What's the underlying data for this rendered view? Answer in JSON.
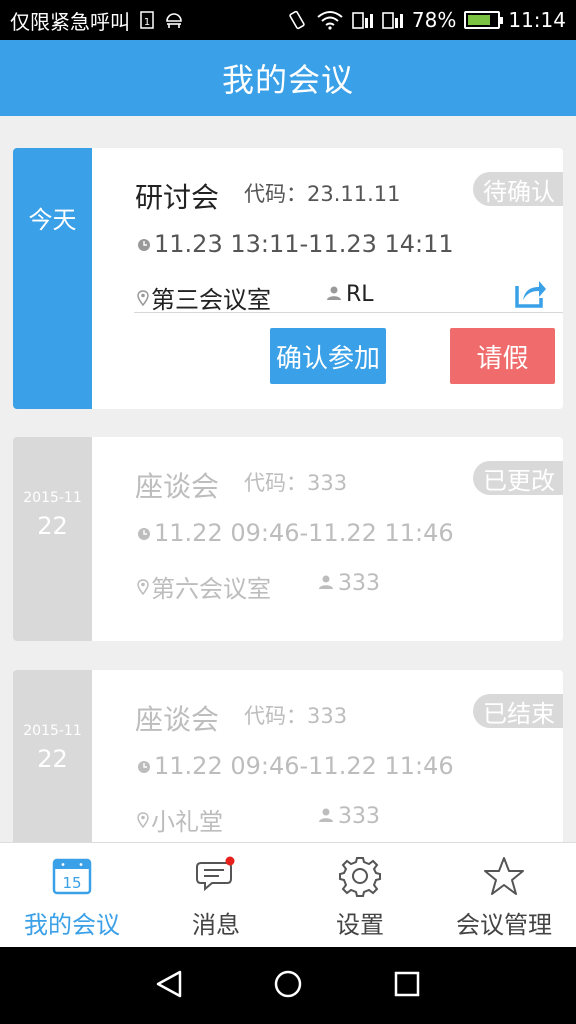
{
  "status_bar": {
    "emergency_text": "仅限紧急呼叫",
    "battery_percent": "78%",
    "battery_level": 0.78,
    "time": "11:14",
    "sim_label": "1"
  },
  "appbar": {
    "title": "我的会议"
  },
  "colors": {
    "primary": "#3aa0e8",
    "danger": "#f06b6b",
    "muted": "#d9d9d9"
  },
  "meetings": [
    {
      "day_label": "今天",
      "title": "研讨会",
      "code_label": "代码：",
      "code": "23.11.11",
      "status": "待确认",
      "time": "11.23 13:11-11.23 14:11",
      "room": "第三会议室",
      "host": "RL",
      "confirm_label": "确认参加",
      "leave_label": "请假"
    },
    {
      "date_ym": "2015-11",
      "date_day": "22",
      "title": "座谈会",
      "code_label": "代码：",
      "code": "333",
      "status": "已更改",
      "time": "11.22 09:46-11.22 11:46",
      "room": "第六会议室",
      "host": "333"
    },
    {
      "date_ym": "2015-11",
      "date_day": "22",
      "title": "座谈会",
      "code_label": "代码：",
      "code": "333",
      "status": "已结束",
      "time": "11.22 09:46-11.22 11:46",
      "room": "小礼堂",
      "host": "333"
    }
  ],
  "tabs": [
    {
      "label": "我的会议",
      "icon": "calendar-icon",
      "calendar_day": "15",
      "active": true
    },
    {
      "label": "消息",
      "icon": "message-icon",
      "has_badge": true
    },
    {
      "label": "设置",
      "icon": "gear-icon"
    },
    {
      "label": "会议管理",
      "icon": "star-icon"
    }
  ]
}
